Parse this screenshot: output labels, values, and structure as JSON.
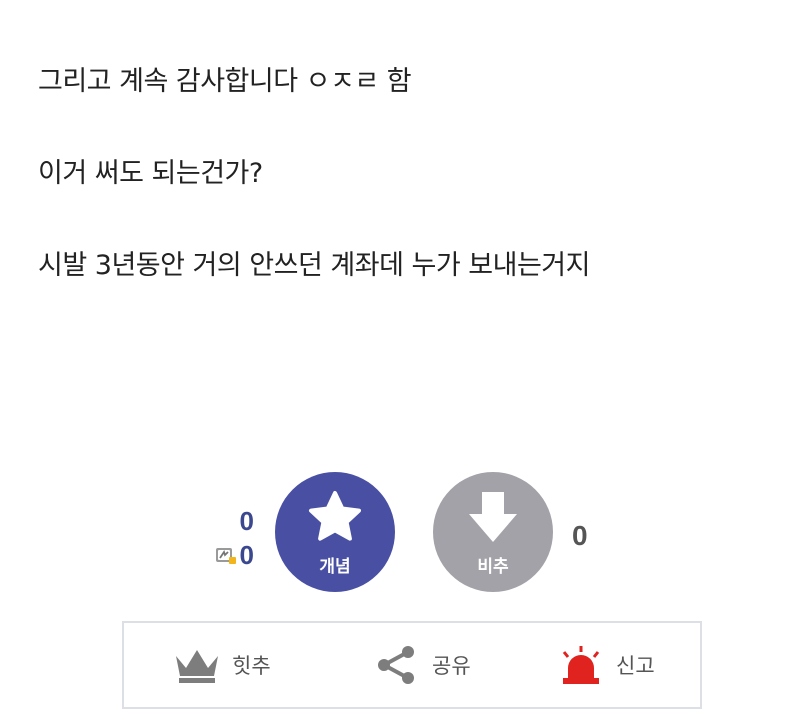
{
  "post": {
    "lines": [
      "그리고 계속 감사합니다 ㅇㅈㄹ 함",
      "이거 써도 되는건가?",
      "시발 3년동안 거의 안쓰던 계좌데 누가 보내는거지"
    ]
  },
  "vote": {
    "up_count": "0",
    "fixed_count": "0",
    "up_label": "개념",
    "down_label": "비추",
    "down_count": "0",
    "up_color": "#4950a3",
    "down_color": "#a2a2a8",
    "count_color": "#3b4890"
  },
  "actions": {
    "hit_label": "힛추",
    "share_label": "공유",
    "report_label": "신고",
    "report_color": "#e0231e",
    "icons": [
      "crown-icon",
      "share-icon",
      "siren-icon"
    ]
  }
}
